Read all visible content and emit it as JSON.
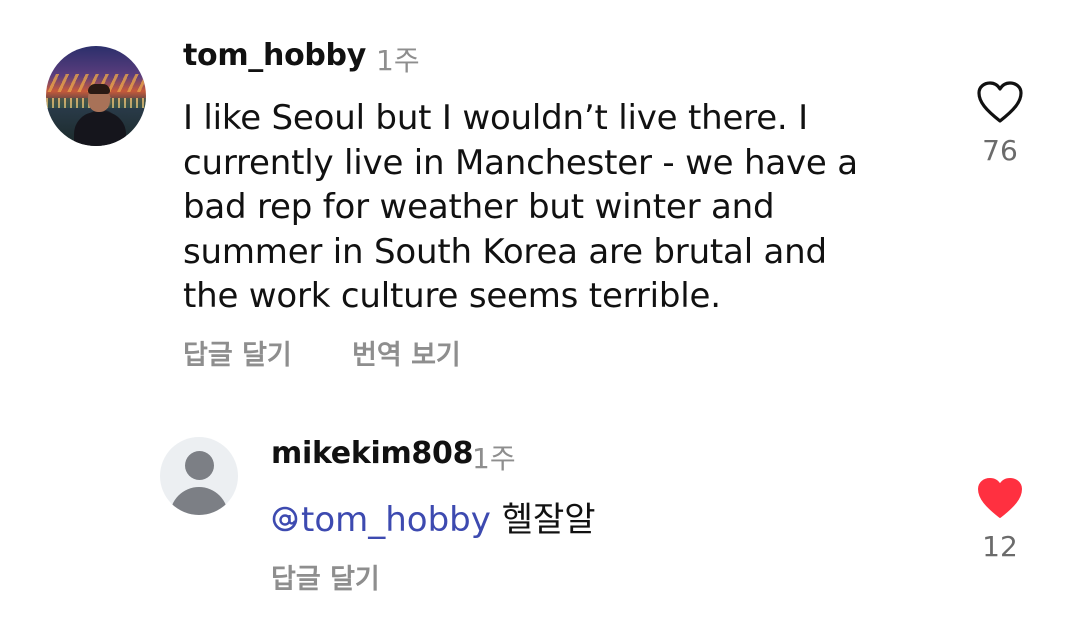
{
  "comment": {
    "username": "tom_hobby",
    "time": "1주",
    "lines": [
      "I like Seoul but I wouldn’t live there. I",
      "currently live in Manchester - we have a",
      "bad rep for weather but winter and",
      "summer in South Korea are brutal and",
      "the work culture seems terrible."
    ],
    "reply_label": "답글 달기",
    "translate_label": "번역 보기",
    "likes": "76",
    "liked": false
  },
  "reply": {
    "username": "mikekim808",
    "time": "1주",
    "mention": "tom_hobby",
    "text": "헬잘알",
    "reply_label": "답글 달기",
    "likes": "12",
    "liked": true
  },
  "colors": {
    "text": "#111111",
    "muted": "#8e8e8e",
    "mention": "#3d4ab0",
    "heart_active": "#ff3040"
  },
  "icons": {
    "like_outline": "heart-outline-icon",
    "like_filled": "heart-filled-icon",
    "threads_mention": "threads-at-icon"
  }
}
